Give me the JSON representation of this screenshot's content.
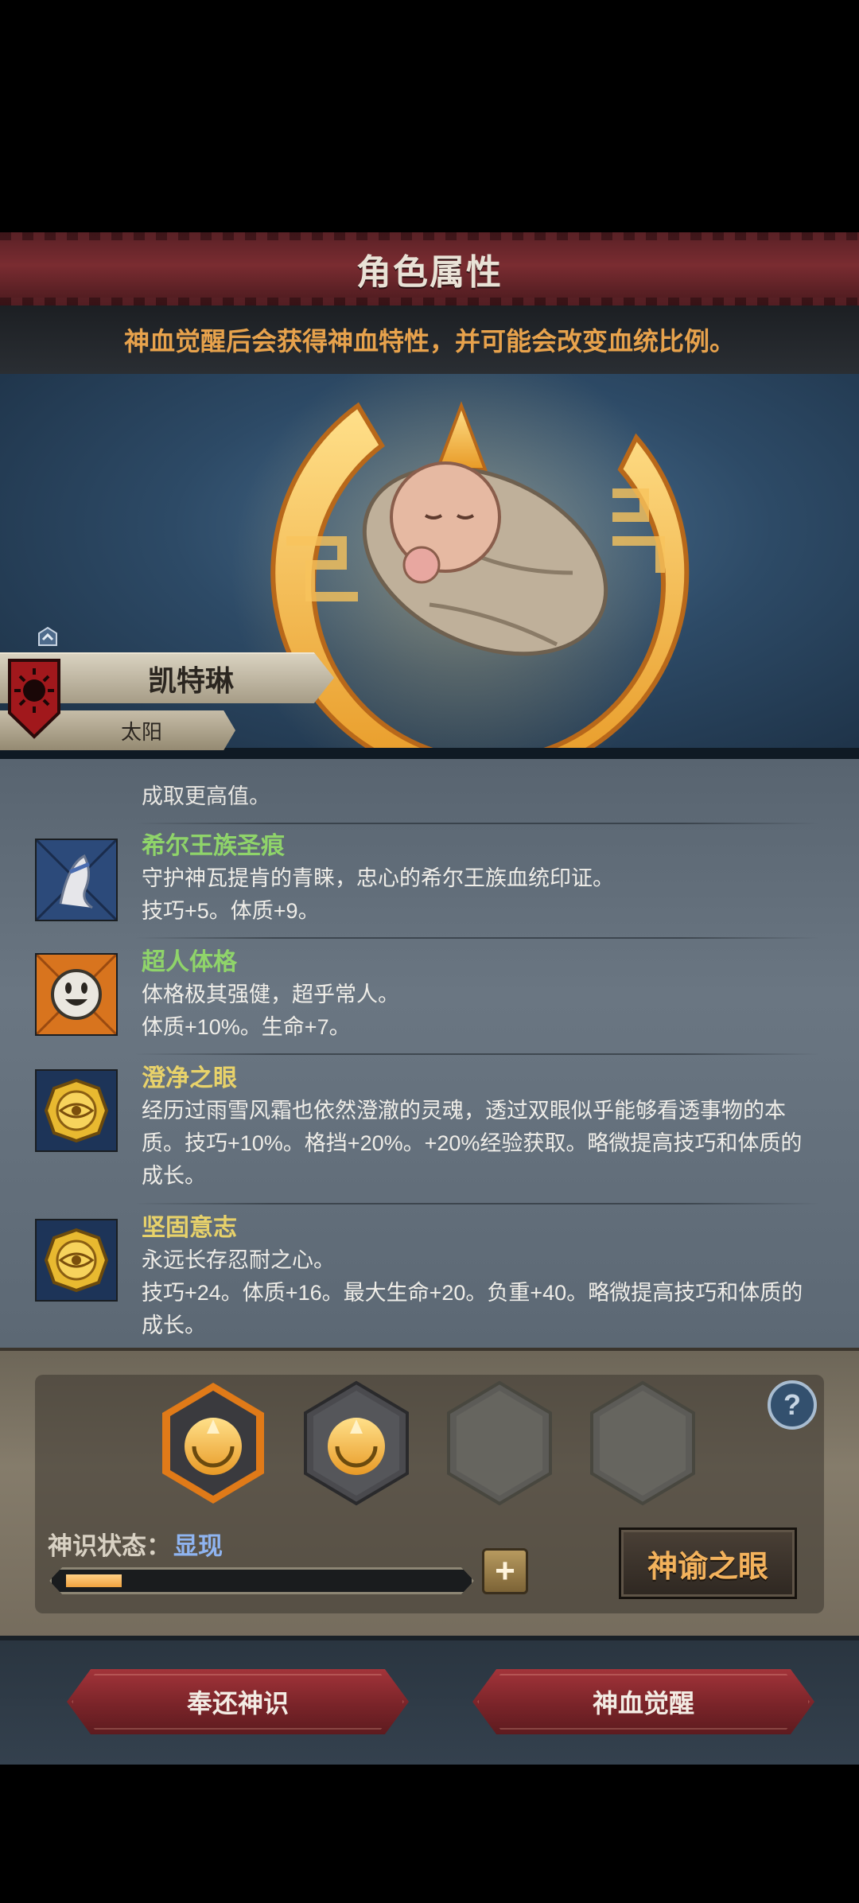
{
  "header": {
    "title": "角色属性"
  },
  "notice": {
    "text": "神血觉醒后会获得神血特性，并可能会改变血统比例。"
  },
  "character": {
    "name": "凯特琳",
    "subtitle": "太阳"
  },
  "traits": {
    "cutoff_text": "成取更高值。",
    "items": [
      {
        "name": "希尔王族圣痕",
        "name_color": "#8fd46a",
        "desc": "守护神瓦提肯的青睐，忠心的希尔王族血统印证。\n技巧+5。体质+9。"
      },
      {
        "name": "超人体格",
        "name_color": "#8fd46a",
        "desc": "体格极其强健，超乎常人。\n体质+10%。生命+7。"
      },
      {
        "name": "澄净之眼",
        "name_color": "#e8d26a",
        "desc": "经历过雨雪风霜也依然澄澈的灵魂，透过双眼似乎能够看透事物的本质。技巧+10%。格挡+20%。+20%经验获取。略微提高技巧和体质的成长。"
      },
      {
        "name": "坚固意志",
        "name_color": "#e8d26a",
        "desc": "永远长存忍耐之心。\n技巧+24。体质+16。最大生命+20。负重+40。略微提高技巧和体质的成长。"
      }
    ]
  },
  "panel": {
    "state_label": "神识状态：",
    "state_value": "显现",
    "progress": 0.14,
    "plus_label": "+",
    "oracle_button": "神谕之眼",
    "slots": [
      "filled-selected",
      "filled",
      "empty",
      "empty"
    ]
  },
  "footer": {
    "return_button": "奉还神识",
    "awaken_button": "神血觉醒"
  },
  "colors": {
    "header_red": "#7a2c31",
    "notice_orange": "#e7a24c",
    "state_blue": "#8fb4f0",
    "progress_orange": "#f0a23f"
  }
}
